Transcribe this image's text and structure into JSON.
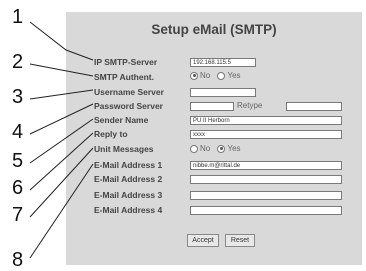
{
  "title": "Setup eMail (SMTP)",
  "callouts": [
    "1",
    "2",
    "3",
    "4",
    "5",
    "6",
    "7",
    "8"
  ],
  "form": {
    "ip_label": "IP SMTP-Server",
    "ip_value": "192.168.115.5",
    "auth_label": "SMTP Authent.",
    "auth_no": "No",
    "auth_yes": "Yes",
    "auth_selected": "No",
    "username_label": "Username Server",
    "username_value": "",
    "password_label": "Password Server",
    "password_value": "",
    "retype_label": "Retype",
    "retype_value": "",
    "sender_label": "Sender Name",
    "sender_value": "PU II Herborn",
    "reply_label": "Reply to",
    "reply_value": "xxxx",
    "unit_label": "Unit Messages",
    "unit_no": "No",
    "unit_yes": "Yes",
    "unit_selected": "Yes",
    "email1_label": "E-Mail Address 1",
    "email1_value": "nibbe.m@rittal.de",
    "email2_label": "E-Mail Address 2",
    "email2_value": "",
    "email3_label": "E-Mail Address 3",
    "email3_value": "",
    "email4_label": "E-Mail Address 4",
    "email4_value": ""
  },
  "buttons": {
    "accept": "Accept",
    "reset": "Reset"
  }
}
